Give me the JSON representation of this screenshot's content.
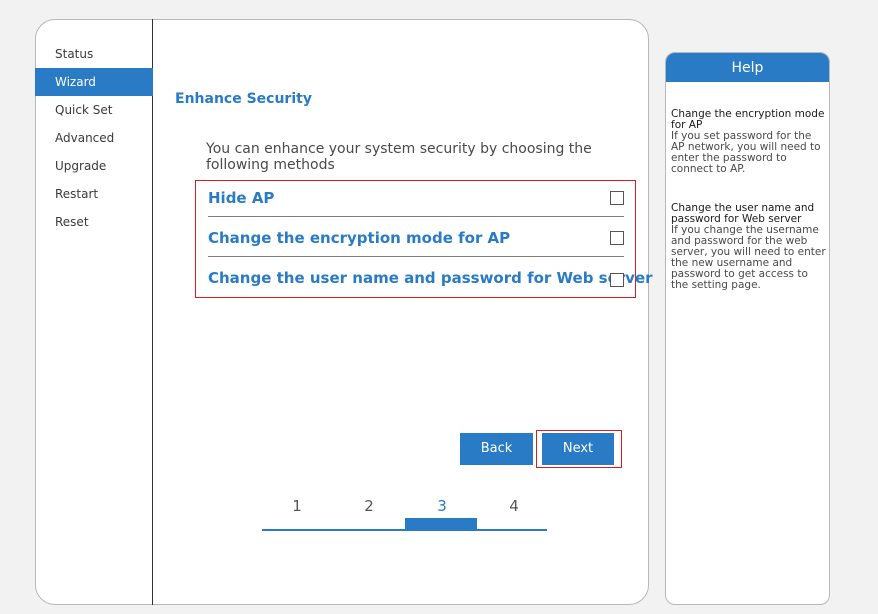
{
  "nav": {
    "items": [
      {
        "label": "Status",
        "active": false
      },
      {
        "label": "Wizard",
        "active": true
      },
      {
        "label": "Quick Set",
        "active": false
      },
      {
        "label": "Advanced",
        "active": false
      },
      {
        "label": "Upgrade",
        "active": false
      },
      {
        "label": "Restart",
        "active": false
      },
      {
        "label": "Reset",
        "active": false
      }
    ]
  },
  "main": {
    "title": "Enhance Security",
    "intro": "You can enhance your system security by choosing the following methods",
    "options": [
      {
        "label": "Hide AP",
        "checked": false
      },
      {
        "label": "Change the encryption mode for AP",
        "checked": false
      },
      {
        "label": "Change the user name and password for Web server",
        "checked": false
      }
    ],
    "back_label": "Back",
    "next_label": "Next",
    "steps": [
      "1",
      "2",
      "3",
      "4"
    ],
    "current_step": 3
  },
  "help": {
    "title": "Help",
    "section1_heading": "Change the encryption mode for AP",
    "section1_text": "If you set password for the AP network, you will need to enter the password to connect to AP.",
    "section2_heading": "Change the user name and password for Web server",
    "section2_text": "If you change the username and password for the web server, you will need to enter the new username and password to get access to the setting page."
  },
  "colors": {
    "accent": "#2a7bc5",
    "highlight": "#d71e1e"
  }
}
